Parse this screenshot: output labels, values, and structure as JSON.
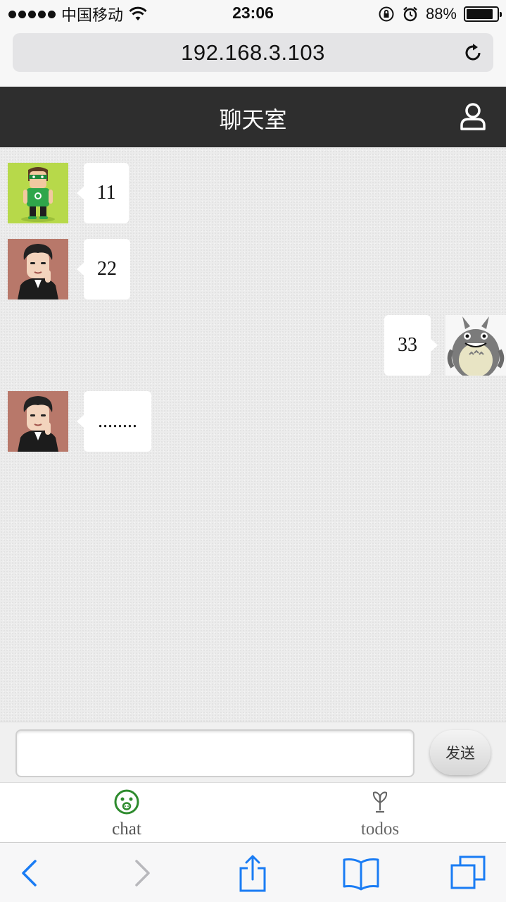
{
  "status_bar": {
    "carrier": "中国移动",
    "time": "23:06",
    "battery": "88%",
    "battery_level": 0.88
  },
  "browser": {
    "url": "192.168.3.103"
  },
  "header": {
    "title": "聊天室"
  },
  "messages": [
    {
      "side": "left",
      "avatar": "green-hero-avatar",
      "text": "11"
    },
    {
      "side": "left",
      "avatar": "man-avatar",
      "text": "22"
    },
    {
      "side": "right",
      "avatar": "totoro-avatar",
      "text": "33"
    },
    {
      "side": "left",
      "avatar": "man-avatar",
      "text": "........"
    }
  ],
  "composer": {
    "input_value": "",
    "send_label": "发送"
  },
  "tabs": [
    {
      "label": "chat",
      "icon": "chat-face-icon",
      "active": true,
      "color": "#2e8b2e"
    },
    {
      "label": "todos",
      "icon": "todos-cup-icon",
      "active": false,
      "color": "#666666"
    }
  ],
  "colors": {
    "header_bg": "#2e2e2e",
    "accent_blue": "#1a7cf4",
    "active_tab": "#2e8b2e"
  }
}
